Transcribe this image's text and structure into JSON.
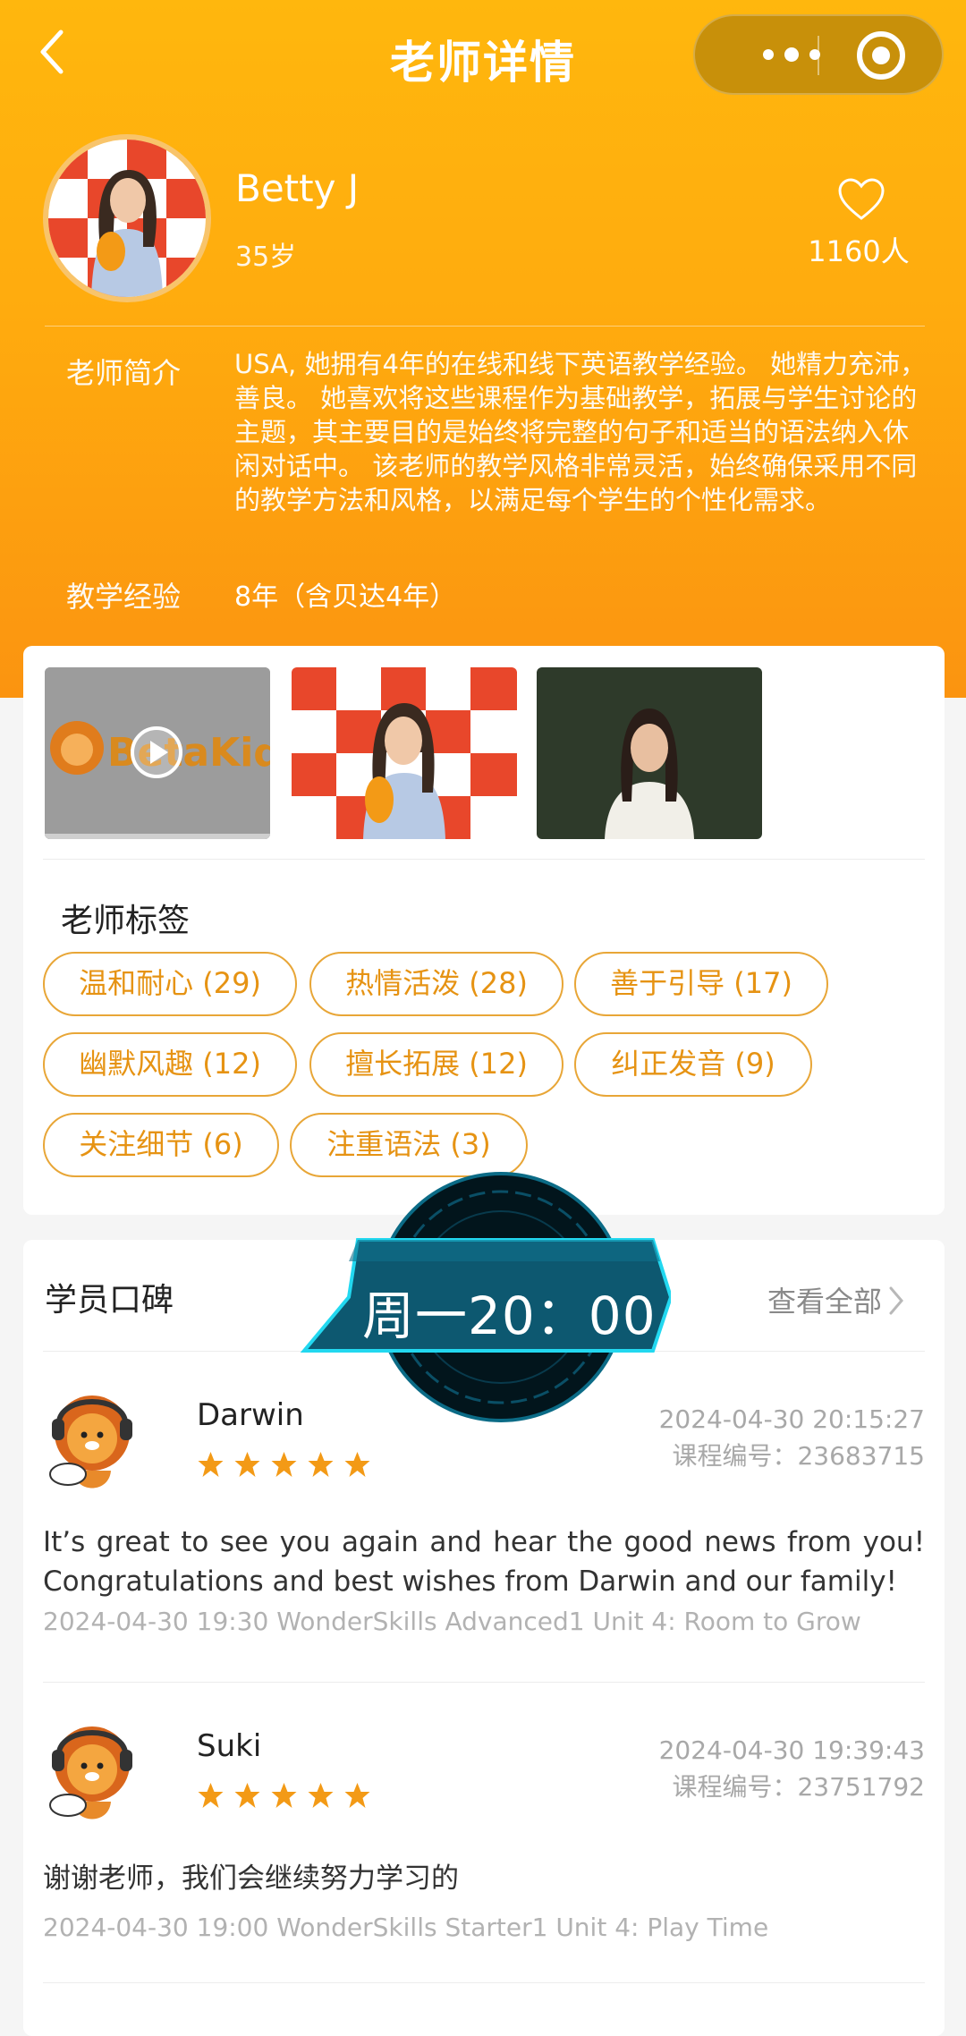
{
  "nav": {
    "title": "老师详情"
  },
  "teacher": {
    "name": "Betty J",
    "age": "35岁",
    "likes": "1160人",
    "intro_label": "老师简介",
    "intro": "USA, 她拥有4年的在线和线下英语教学经验。 她精力充沛，善良。 她喜欢将这些课程作为基础教学，拓展与学生讨论的主题，其主要目的是始终将完整的句子和适当的语法纳入休闲对话中。 该老师的教学风格非常灵活，始终确保采用不同的教学方法和风格，以满足每个学生的个性化需求。",
    "experience_label": "教学经验",
    "experience": "8年（含贝达4年）"
  },
  "media": {
    "video_logo": "BetaKid",
    "banner_text": "BetaKid"
  },
  "tags_section": {
    "title": "老师标签",
    "tags": [
      "温和耐心 (29)",
      "热情活泼 (28)",
      "善于引导 (17)",
      "幽默风趣 (12)",
      "擅长拓展 (12)",
      "纠正发音 (9)",
      "关注细节 (6)",
      "注重语法 (3)"
    ]
  },
  "reviews_section": {
    "title": "学员口碑",
    "view_all": "查看全部",
    "reviews": [
      {
        "name": "Darwin",
        "rating": 5,
        "time": "2024-04-30 20:15:27",
        "course": "课程编号：23683715",
        "text": "It’s great to see you again and hear the good news from you! Congratulations and best wishes from Darwin and our family!",
        "meta": "2024-04-30 19:30    WonderSkills Advanced1 Unit 4: Room to Grow"
      },
      {
        "name": "Suki",
        "rating": 5,
        "time": "2024-04-30 19:39:43",
        "course": "课程编号：23751792",
        "text": "谢谢老师，我们会继续努力学习的",
        "meta": "2024-04-30 19:00    WonderSkills Starter1 Unit 4: Play Time"
      }
    ]
  },
  "overlay": {
    "schedule": "周一20：00"
  },
  "colors": {
    "brand_orange": "#ffab0e",
    "tag_orange": "#e69313",
    "star": "#f39a16"
  }
}
